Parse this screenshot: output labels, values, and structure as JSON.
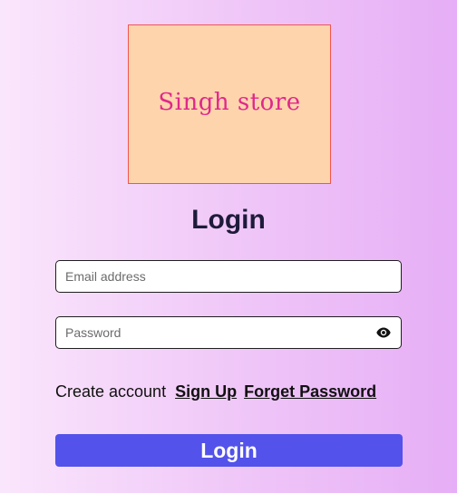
{
  "logo": {
    "text": "Singh store"
  },
  "title": "Login",
  "form": {
    "email": {
      "placeholder": "Email address",
      "value": ""
    },
    "password": {
      "placeholder": "Password",
      "value": "",
      "toggle_icon": "eye-icon"
    }
  },
  "links": {
    "prompt": "Create account",
    "sign_up": "Sign Up",
    "forget_password": "Forget Password"
  },
  "submit": {
    "label": "Login"
  },
  "colors": {
    "accent": "#5352eb",
    "logo_bg": "#fed4ad",
    "logo_text": "#e0288a",
    "title": "#1e1b3a"
  }
}
